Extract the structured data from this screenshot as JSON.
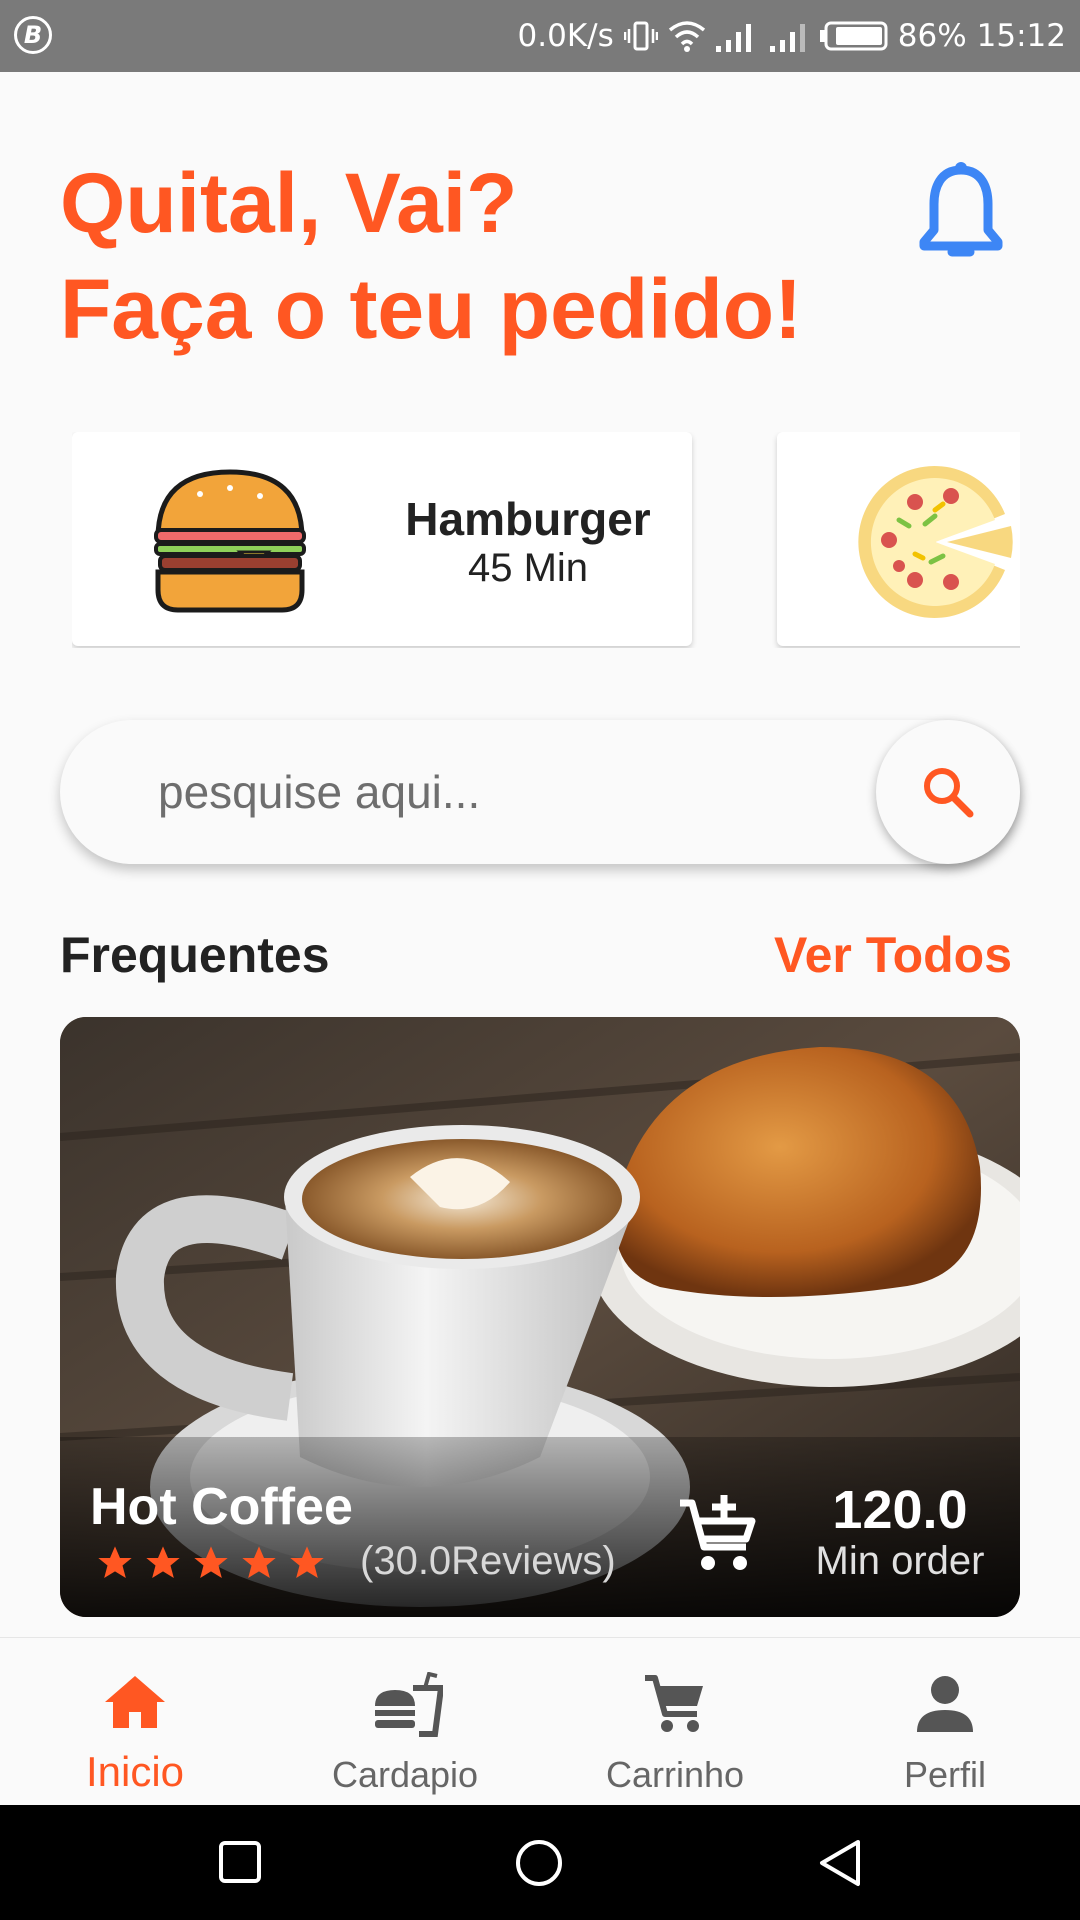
{
  "status_bar": {
    "net_speed": "0.0K/s",
    "battery": "86%",
    "time": "15:12",
    "badge_letter": "B"
  },
  "header": {
    "line1": "Quital, Vai?",
    "line2": "Faça o teu pedido!",
    "accent_color": "#ff5722",
    "bell_color": "#3d86f5"
  },
  "categories": [
    {
      "name": "Hamburger",
      "time": "45 Min",
      "icon": "hamburger-icon"
    },
    {
      "name": "",
      "time": "",
      "icon": "pizza-icon"
    }
  ],
  "search": {
    "placeholder": "pesquise aqui...",
    "icon": "search-icon"
  },
  "section": {
    "title": "Frequentes",
    "see_all": "Ver Todos"
  },
  "featured": {
    "name": "Hot Coffee",
    "rating": 5,
    "reviews": "(30.0Reviews)",
    "price": "120.0",
    "price_caption": "Min order",
    "cart_icon": "cart-plus-icon"
  },
  "bottom_nav": {
    "items": [
      {
        "label": "Inicio",
        "icon": "home-icon",
        "active": true
      },
      {
        "label": "Cardapio",
        "icon": "fastfood-icon",
        "active": false
      },
      {
        "label": "Carrinho",
        "icon": "cart-icon",
        "active": false
      },
      {
        "label": "Perfil",
        "icon": "person-icon",
        "active": false
      }
    ]
  }
}
